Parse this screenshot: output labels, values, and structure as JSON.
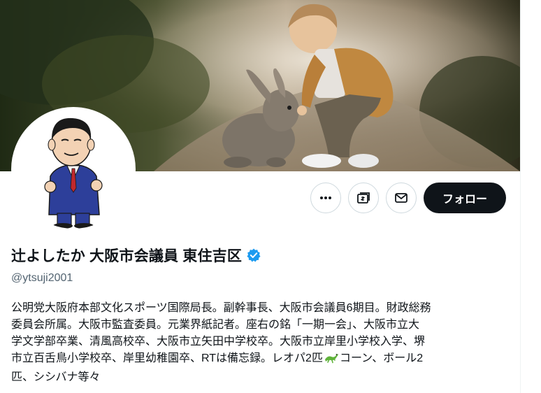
{
  "profile": {
    "display_name": "辻よしたか 大阪市会議員 東住吉区",
    "handle": "@ytsuji2001",
    "bio_lines": [
      "公明党大阪府本部文化スポーツ国際局長。副幹事長、大阪市会議員6期目。財政総務",
      "委員会所属。大阪市監査委員。元業界紙記者。座右の銘「一期一会」、大阪市立大",
      "学文学部卒業、清風高校卒、大阪市立矢田中学校卒。大阪市立岸里小学校入学、堺",
      "市立百舌鳥小学校卒、岸里幼稚園卒、RTは備忘録。レオパ2匹",
      "コーン、ボール2",
      "匹、シシバナ等々"
    ],
    "verified_icon": "verified-badge-icon"
  },
  "actions": {
    "more_icon": "more-icon",
    "subscribe_icon": "subscribe-icon",
    "message_icon": "mail-icon",
    "follow_label": "フォロー"
  },
  "colors": {
    "verified": "#1d9bf0",
    "follow_bg": "#0f1419",
    "handle": "#536471",
    "border": "#cfd9de"
  }
}
